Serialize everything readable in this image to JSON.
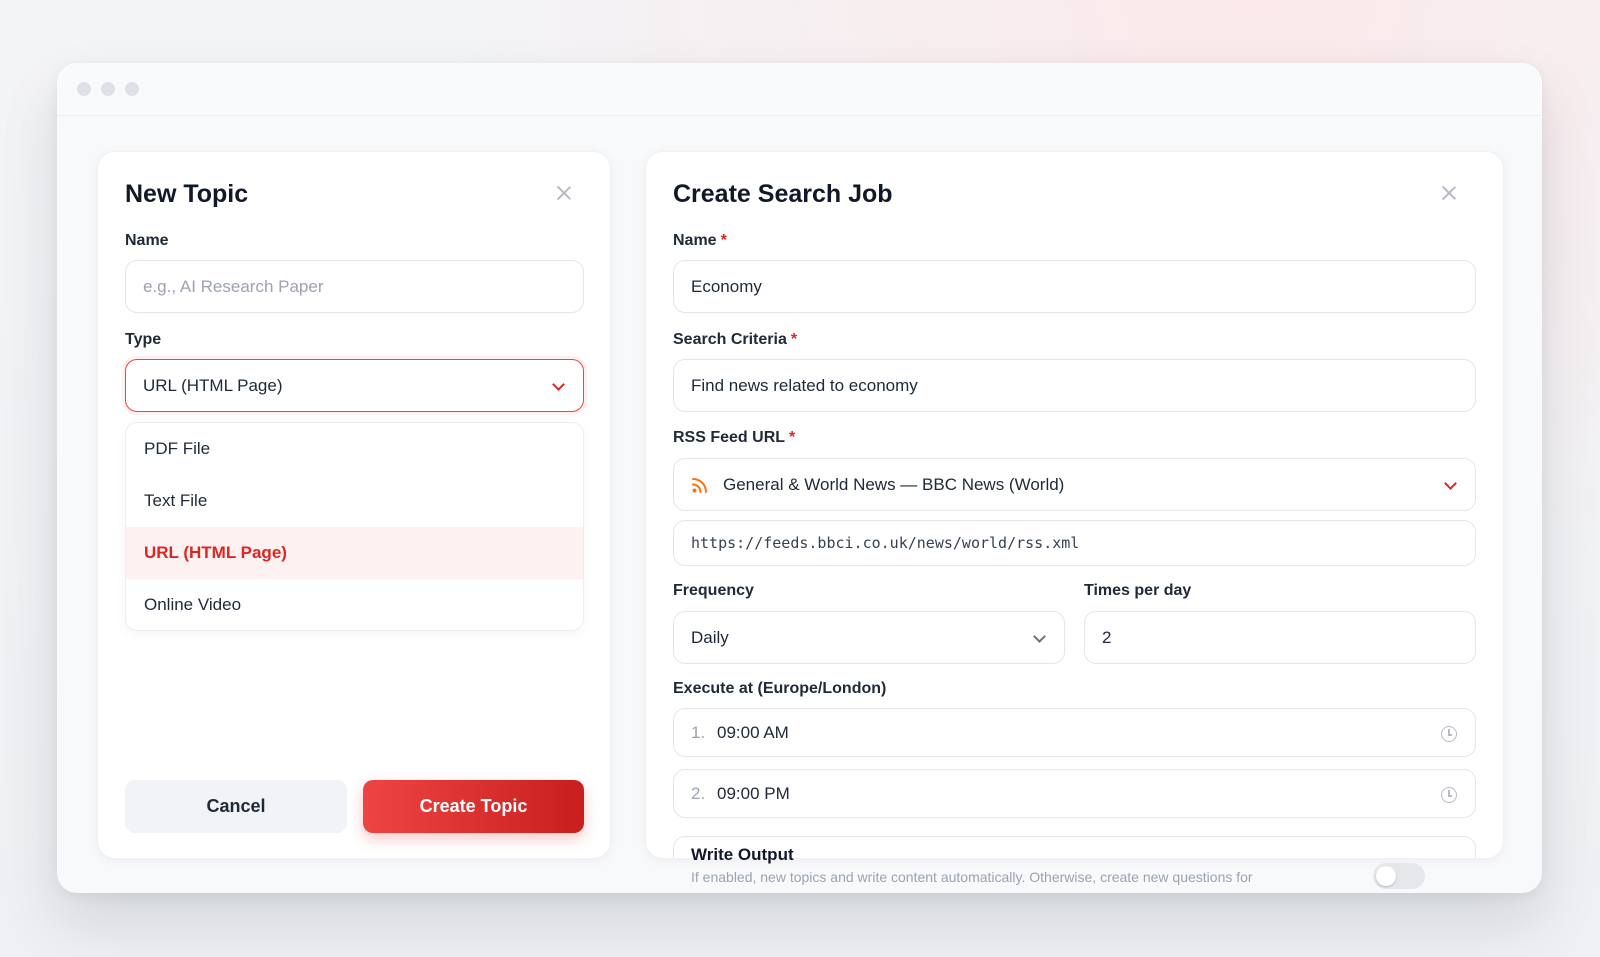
{
  "new_topic": {
    "title": "New Topic",
    "name_label": "Name",
    "name_placeholder": "e.g., AI Research Paper",
    "type_label": "Type",
    "type_selected": "URL (HTML Page)",
    "type_options": [
      "PDF File",
      "Text File",
      "URL (HTML Page)",
      "Online Video"
    ],
    "cancel_label": "Cancel",
    "create_label": "Create Topic"
  },
  "search_job": {
    "title": "Create Search Job",
    "name_label": "Name",
    "name_value": "Economy",
    "criteria_label": "Search Criteria",
    "criteria_value": "Find news related to economy",
    "rss_label": "RSS Feed URL",
    "rss_selected": "General & World News — BBC News (World)",
    "rss_url": "https://feeds.bbci.co.uk/news/world/rss.xml",
    "frequency_label": "Frequency",
    "frequency_value": "Daily",
    "times_label": "Times per day",
    "times_value": "2",
    "execute_label": "Execute at (Europe/London)",
    "times": [
      {
        "index": "1.",
        "value": "09:00 AM"
      },
      {
        "index": "2.",
        "value": "09:00 PM"
      }
    ],
    "write_output_label": "Write Output",
    "write_output_desc": "If enabled, new topics and write content automatically. Otherwise, create new questions for"
  },
  "colors": {
    "accent": "#dc2626",
    "rss_icon": "#f97316"
  }
}
